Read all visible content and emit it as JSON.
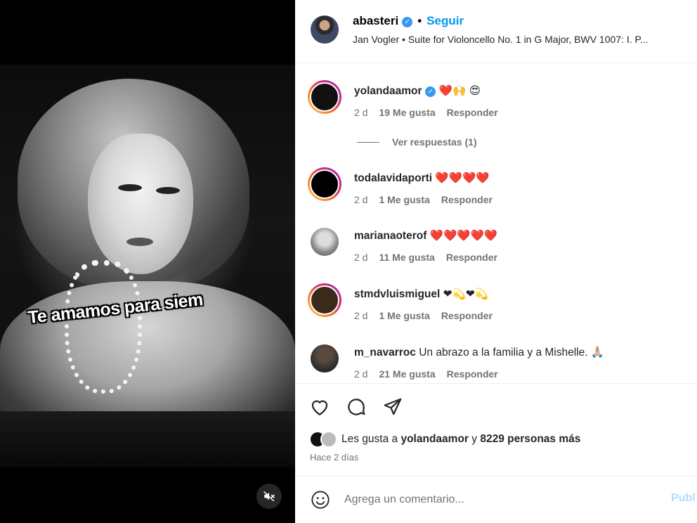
{
  "media": {
    "caption": "Te amamos para siem"
  },
  "header": {
    "username": "abasteri",
    "verified_mark": "✓",
    "separator": "•",
    "follow_label": "Seguir",
    "audio": "Jan Vogler • Suite for Violoncello No. 1 in G Major, BWV 1007: I. P..."
  },
  "comments": [
    {
      "user": "yolandaamor",
      "verified": true,
      "text": "❤️🙌 😍",
      "time": "2 d",
      "likes": "19 Me gusta",
      "reply": "Responder"
    },
    {
      "user": "todalavidaporti",
      "verified": false,
      "text": "❤️❤️❤️❤️",
      "time": "2 d",
      "likes": "1 Me gusta",
      "reply": "Responder"
    },
    {
      "user": "marianaoterof",
      "verified": false,
      "text": "❤️❤️❤️❤️❤️",
      "time": "2 d",
      "likes": "11 Me gusta",
      "reply": "Responder"
    },
    {
      "user": "stmdvluismiguel",
      "verified": false,
      "text": "❤💫❤💫",
      "time": "2 d",
      "likes": "1 Me gusta",
      "reply": "Responder"
    },
    {
      "user": "m_navarroc",
      "verified": false,
      "text": "Un abrazo a la familia y a Mishelle. 🙏🏼",
      "time": "2 d",
      "likes": "21 Me gusta",
      "reply": "Responder"
    }
  ],
  "view_replies": "Ver respuestas (1)",
  "likes_summary": {
    "prefix": "Les gusta a",
    "user": "yolandaamor",
    "connector": "y",
    "others": "8229 personas más"
  },
  "posted_ago": "Hace 2 días",
  "add_comment": {
    "placeholder": "Agrega un comentario...",
    "publish_label": "Publ"
  },
  "colors": {
    "accent": "#0095f6",
    "verified": "#3897f0",
    "muted_text": "#737373"
  },
  "icons": [
    "heart-icon",
    "comment-icon",
    "share-icon",
    "smile-icon",
    "mute-icon",
    "verified-badge-icon"
  ]
}
